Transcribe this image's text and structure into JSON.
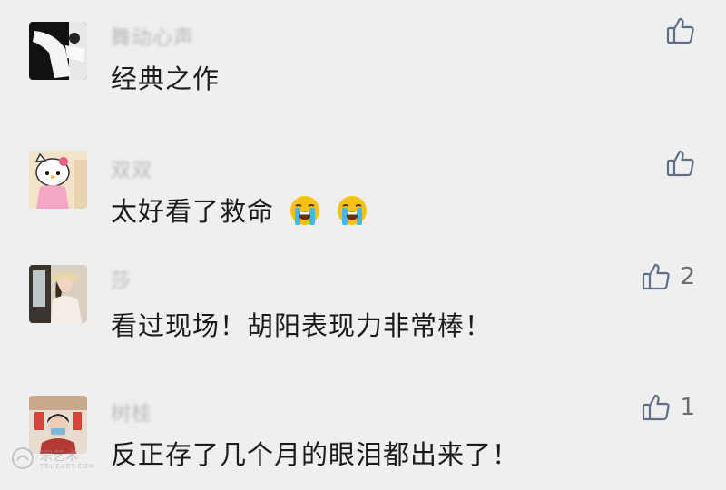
{
  "comments": [
    {
      "name": "舞动心声",
      "text": "经典之作",
      "likes": ""
    },
    {
      "name": "双双",
      "text": "太好看了救命",
      "emoji_count": 2,
      "emoji_icon": "loudly-crying-face-icon",
      "likes": ""
    },
    {
      "name": "莎",
      "text": "看过现场！胡阳表现力非常棒！",
      "likes": "2"
    },
    {
      "name": "树桂",
      "text": "反正存了几个月的眼泪都出来了！",
      "likes": "1"
    }
  ],
  "watermark": {
    "text": "宗艺术",
    "sub": "TRUEART.COM"
  },
  "colors": {
    "background": "#efefef",
    "text": "#1b1b1b",
    "name": "#b9b9b9",
    "icon": "#5f6f8a"
  }
}
